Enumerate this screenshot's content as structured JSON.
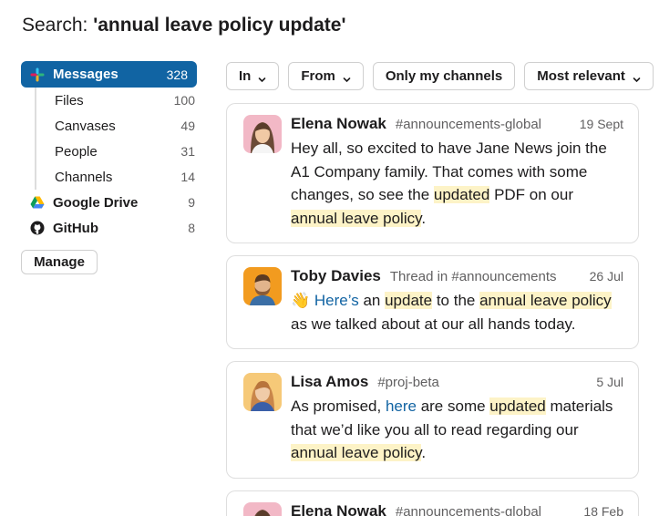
{
  "search": {
    "prefix": "Search: ",
    "query": "'annual leave policy update'"
  },
  "sidebar": {
    "messages": {
      "label": "Messages",
      "count": "328",
      "icon": "slack-icon"
    },
    "sub_items": [
      {
        "label": "Files",
        "count": "100"
      },
      {
        "label": "Canvases",
        "count": "49"
      },
      {
        "label": "People",
        "count": "31"
      },
      {
        "label": "Channels",
        "count": "14"
      }
    ],
    "integrations": [
      {
        "label": "Google Drive",
        "count": "9",
        "icon": "google-drive-icon"
      },
      {
        "label": "GitHub",
        "count": "8",
        "icon": "github-icon"
      }
    ],
    "manage_label": "Manage"
  },
  "filters": [
    {
      "label": "In"
    },
    {
      "label": "From"
    },
    {
      "label": "Only my channels"
    },
    {
      "label": "Most relevant"
    }
  ],
  "results": [
    {
      "name": "Elena Nowak",
      "channel": "#announcements-global",
      "date": "19 Sept",
      "body": {
        "t1": "Hey all, so excited to have Jane News join the A1 Company family. That comes with some changes, so see the ",
        "h1": "updated",
        "t2": " PDF on our ",
        "h2": "annual leave policy",
        "t3": "."
      }
    },
    {
      "name": "Toby Davies",
      "channel": "Thread in #announcements",
      "date": "26 Jul",
      "body": {
        "emoji": "👋",
        "link": "Here’s",
        "t1": " an ",
        "h1": "update",
        "t2": " to the ",
        "h2": "annual leave policy",
        "t3": " as we talked about at our all hands today."
      }
    },
    {
      "name": "Lisa Amos",
      "channel": "#proj-beta",
      "date": "5 Jul",
      "body": {
        "t1": "As promised, ",
        "link": "here",
        "t2": " are some ",
        "h1": "updated",
        "t3": " materials that we’d like you all to read regarding our ",
        "h2": "annual leave policy",
        "t4": "."
      }
    },
    {
      "name": "Elena Nowak",
      "channel": "#announcements-global",
      "date": "18 Feb"
    }
  ],
  "colors": {
    "accent": "#1164a3",
    "highlight": "#fdf3c7",
    "link": "#1264a3"
  }
}
